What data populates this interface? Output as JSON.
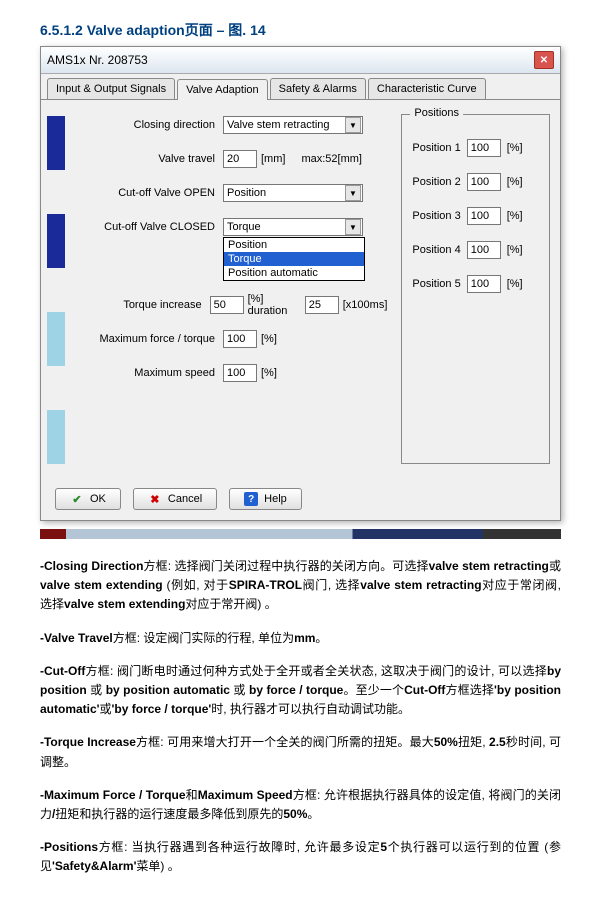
{
  "heading": "6.5.1.2 Valve adaption页面 – 图. 14",
  "title": "AMS1x Nr. 208753",
  "tabs": {
    "t0": "Input & Output Signals",
    "t1": "Valve Adaption",
    "t2": "Safety & Alarms",
    "t3": "Characteristic Curve"
  },
  "form": {
    "closing_dir_lbl": "Closing direction",
    "closing_dir_val": "Valve stem retracting",
    "valve_travel_lbl": "Valve travel",
    "valve_travel_val": "20",
    "valve_travel_unit": "[mm]",
    "valve_travel_max": "max:52[mm]",
    "cutoff_open_lbl": "Cut-off Valve OPEN",
    "cutoff_open_val": "Position",
    "cutoff_closed_lbl": "Cut-off Valve CLOSED",
    "cutoff_closed_val": "Torque",
    "dd_opt0": "Position",
    "dd_opt1": "Torque",
    "dd_opt2": "Position automatic",
    "torque_inc_lbl": "Torque increase",
    "torque_inc_val": "50",
    "torque_inc_unit": "[%] duration",
    "torque_inc_dur": "25",
    "torque_inc_dur_unit": "[x100ms]",
    "maxforce_lbl": "Maximum force / torque",
    "maxforce_val": "100",
    "maxforce_unit": "[%]",
    "maxspeed_lbl": "Maximum speed",
    "maxspeed_val": "100",
    "maxspeed_unit": "[%]"
  },
  "positions": {
    "title": "Positions",
    "p1l": "Position 1",
    "p1v": "100",
    "u": "[%]",
    "p2l": "Position 2",
    "p2v": "100",
    "p3l": "Position 3",
    "p3v": "100",
    "p4l": "Position 4",
    "p4v": "100",
    "p5l": "Position 5",
    "p5v": "100"
  },
  "buttons": {
    "ok": "OK",
    "cancel": "Cancel",
    "help": "Help"
  },
  "desc": {
    "d1a": "-Closing Direction",
    "d1b": "方框: 选择阀门关闭过程中执行器的关闭方向。可选择",
    "d1c": "valve stem retracting",
    "d1d": "或",
    "d1e": "valve stem extending",
    "d1f": " (例如, 对于",
    "d1g": "SPIRA-TROL",
    "d1h": "阀门, 选择",
    "d1i": "valve stem retracting",
    "d1j": "对应于常闭阀, 选择",
    "d1k": "valve stem extending",
    "d1l": "对应于常开阀) 。",
    "d2a": "-Valve Travel",
    "d2b": "方框: 设定阀门实际的行程, 单位为",
    "d2c": "mm",
    "d2d": "。",
    "d3a": "-Cut-Off",
    "d3b": "方框: 阀门断电时通过何种方式处于全开或者全关状态, 这取决于阀门的设计, 可以选择",
    "d3c": "by position",
    "d3d": " 或 ",
    "d3e": "by position automatic",
    "d3f": " 或 ",
    "d3g": "by force / torque",
    "d3h": "。至少一个",
    "d3i": "Cut-Off",
    "d3j": "方框选择",
    "d3k": "'by position automatic'",
    "d3l": "或",
    "d3m": "'by force / torque'",
    "d3n": "时, 执行器才可以执行自动调试功能。",
    "d4a": "-Torque Increase",
    "d4b": "方框: 可用来增大打开一个全关的阀门所需的扭矩。最大",
    "d4c": "50%",
    "d4d": "扭矩, ",
    "d4e": "2.5",
    "d4f": "秒时间, 可调整。",
    "d5a": "-Maximum Force / Torque",
    "d5b": "和",
    "d5c": "Maximum Speed",
    "d5d": "方框: 允许根据执行器具体的设定值, 将阀门的关闭力",
    "d5e": "/",
    "d5f": "扭矩和执行器的运行速度最多降低到原先的",
    "d5g": "50%",
    "d5h": "。",
    "d6a": "-Positions",
    "d6b": "方框: 当执行器遇到各种运行故障时, 允许最多设定",
    "d6c": "5",
    "d6d": "个执行器可以运行到的位置 (参见",
    "d6e": "'Safety&Alarm'",
    "d6f": "菜单) 。"
  }
}
